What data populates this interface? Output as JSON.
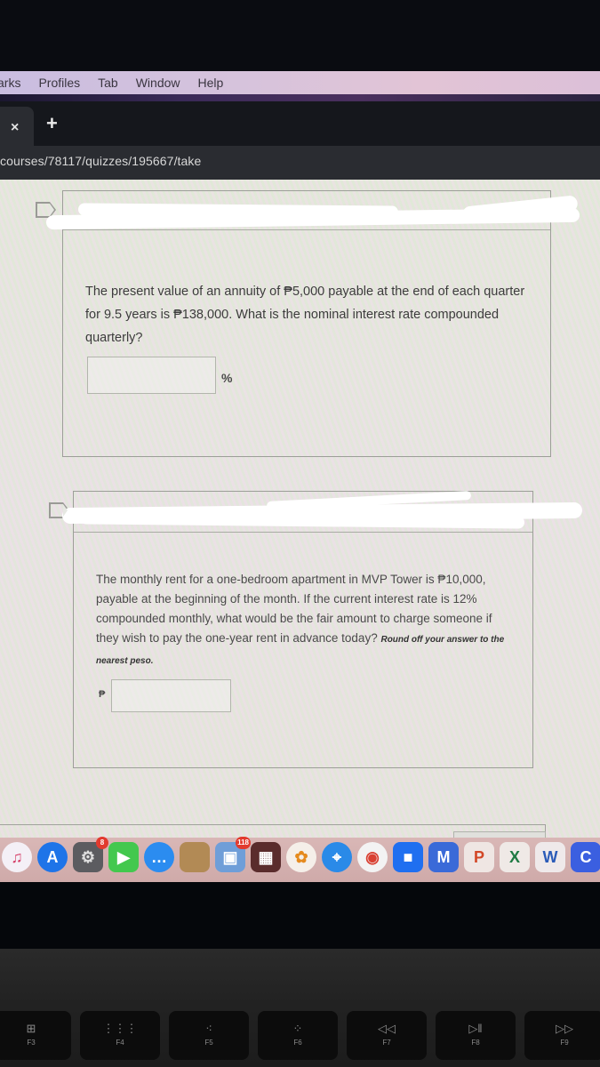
{
  "menubar": {
    "items": [
      "arks",
      "Profiles",
      "Tab",
      "Window",
      "Help"
    ]
  },
  "browser": {
    "tab_close_icon": "×",
    "new_tab_icon": "+",
    "url": "courses/78117/quizzes/195667/take"
  },
  "quiz": {
    "questions": [
      {
        "text": "The present value of an annuity of ₱5,000 payable at the end of each quarter for 9.5 years is ₱138,000. What is the nominal interest rate compounded quarterly?",
        "note": "",
        "answer_value": "",
        "unit": "%",
        "unit_position": "after"
      },
      {
        "text": "The monthly rent for a one-bedroom apartment in MVP Tower is ₱10,000, payable at the beginning of the month. If the current interest rate is 12% compounded monthly, what would be the fair amount to charge someone if they wish to pay the one-year rent in advance today?",
        "note": "Round off your answer to the nearest peso.",
        "answer_value": "",
        "unit": "₱",
        "unit_position": "before"
      }
    ]
  },
  "dock": {
    "apps": [
      {
        "name": "music",
        "glyph": "♫",
        "color": "#f4f0f6",
        "fg": "#d6426a"
      },
      {
        "name": "app-store",
        "glyph": "A",
        "color": "#1e74e8",
        "fg": "#ffffff"
      },
      {
        "name": "system-preferences",
        "glyph": "⚙",
        "color": "#5c5c60",
        "fg": "#e0e0e0",
        "badge": "8"
      },
      {
        "name": "facetime",
        "glyph": "▶",
        "color": "#43c84e",
        "fg": "#ffffff"
      },
      {
        "name": "messages",
        "glyph": "…",
        "color": "#2b8cf0",
        "fg": "#ffffff"
      },
      {
        "name": "notes-folder",
        "glyph": "",
        "color": "#b28a55",
        "fg": "#ffffff"
      },
      {
        "name": "preview",
        "glyph": "▣",
        "color": "#6f9ed8",
        "fg": "#ffffff",
        "badge": "118"
      },
      {
        "name": "photo-booth",
        "glyph": "▦",
        "color": "#5a2c2c",
        "fg": "#ffffff"
      },
      {
        "name": "photos",
        "glyph": "✿",
        "color": "#f5efe9",
        "fg": "#e58a1e"
      },
      {
        "name": "safari",
        "glyph": "⌖",
        "color": "#2a8ae8",
        "fg": "#ffffff"
      },
      {
        "name": "chrome",
        "glyph": "◉",
        "color": "#f3f3f3",
        "fg": "#d94032"
      },
      {
        "name": "zoom",
        "glyph": "■",
        "color": "#1f6ff0",
        "fg": "#ffffff"
      },
      {
        "name": "moodle",
        "glyph": "M",
        "color": "#3a6ad8",
        "fg": "#ffffff"
      },
      {
        "name": "powerpoint",
        "glyph": "P",
        "color": "#efe6e3",
        "fg": "#d24726"
      },
      {
        "name": "excel",
        "glyph": "X",
        "color": "#efe9e6",
        "fg": "#1f7a43"
      },
      {
        "name": "word",
        "glyph": "W",
        "color": "#efe9ea",
        "fg": "#2b5bb8"
      },
      {
        "name": "canva",
        "glyph": "C",
        "color": "#3b5fe0",
        "fg": "#ffffff"
      }
    ]
  },
  "keyboard": {
    "function_keys": [
      {
        "label": "F3",
        "glyph": "⊞"
      },
      {
        "label": "F4",
        "glyph": "⋮⋮⋮"
      },
      {
        "label": "F5",
        "glyph": "⁖"
      },
      {
        "label": "F6",
        "glyph": "⁘"
      },
      {
        "label": "F7",
        "glyph": "◁◁"
      },
      {
        "label": "F8",
        "glyph": "▷‖"
      },
      {
        "label": "F9",
        "glyph": "▷▷"
      }
    ]
  }
}
